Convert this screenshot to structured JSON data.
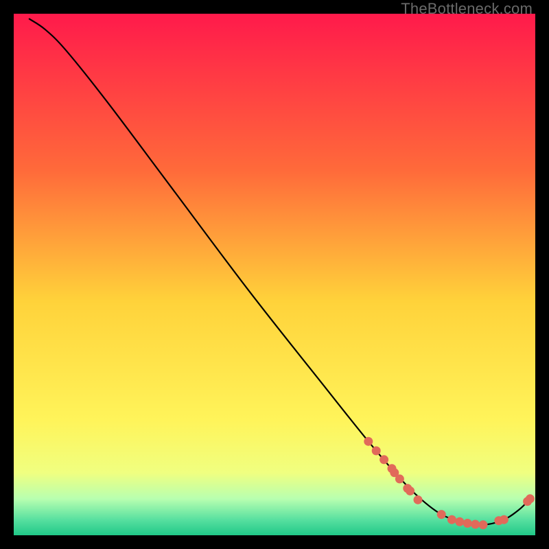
{
  "watermark": "TheBottleneck.com",
  "chart_data": {
    "type": "line",
    "title": "",
    "xlabel": "",
    "ylabel": "",
    "xlim": [
      0,
      100
    ],
    "ylim": [
      0,
      100
    ],
    "gradient_stops": [
      {
        "offset": 0.0,
        "color": "#ff1a4b"
      },
      {
        "offset": 0.3,
        "color": "#ff6a3a"
      },
      {
        "offset": 0.55,
        "color": "#ffd23a"
      },
      {
        "offset": 0.78,
        "color": "#fff45a"
      },
      {
        "offset": 0.88,
        "color": "#f0ff80"
      },
      {
        "offset": 0.93,
        "color": "#b8ffb0"
      },
      {
        "offset": 0.97,
        "color": "#58e0a0"
      },
      {
        "offset": 1.0,
        "color": "#20c888"
      }
    ],
    "series": [
      {
        "name": "bottleneck-curve",
        "points_xy": [
          [
            3,
            99
          ],
          [
            6,
            97
          ],
          [
            10,
            93
          ],
          [
            18,
            83
          ],
          [
            30,
            67
          ],
          [
            45,
            47
          ],
          [
            60,
            28
          ],
          [
            68,
            18
          ],
          [
            74,
            11
          ],
          [
            78,
            7
          ],
          [
            82,
            4
          ],
          [
            86,
            2.5
          ],
          [
            90,
            2
          ],
          [
            94,
            3
          ],
          [
            97,
            5
          ],
          [
            99,
            7
          ]
        ]
      },
      {
        "name": "highlight-dots",
        "points_xy": [
          [
            68.0,
            18.0
          ],
          [
            69.5,
            16.2
          ],
          [
            71.0,
            14.5
          ],
          [
            72.5,
            12.8
          ],
          [
            73.0,
            12.0
          ],
          [
            74.0,
            10.8
          ],
          [
            75.5,
            9.0
          ],
          [
            76.0,
            8.5
          ],
          [
            77.5,
            6.8
          ],
          [
            82.0,
            4.0
          ],
          [
            84.0,
            3.0
          ],
          [
            85.5,
            2.6
          ],
          [
            87.0,
            2.3
          ],
          [
            88.5,
            2.1
          ],
          [
            90.0,
            2.0
          ],
          [
            93.0,
            2.8
          ],
          [
            94.0,
            3.0
          ],
          [
            98.5,
            6.5
          ],
          [
            99.0,
            7.0
          ]
        ],
        "color": "#e16a5a",
        "radius_px": 6.5
      }
    ]
  }
}
